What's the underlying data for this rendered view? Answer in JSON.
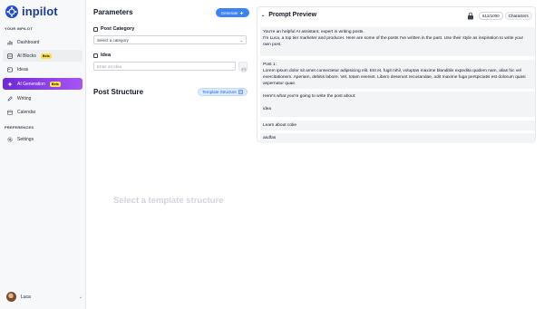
{
  "brand": {
    "name": "inpilot",
    "logo_icon": "inpilot-logo-icon",
    "color": "#1d4ed8"
  },
  "sidebar": {
    "section_main": "YOUR INPILOT",
    "items": [
      {
        "label": "Dashboard",
        "icon": "bar-chart-icon"
      },
      {
        "label": "AI Blocks",
        "icon": "blocks-icon",
        "badge": "Beta"
      },
      {
        "label": "Ideas",
        "icon": "image-icon"
      },
      {
        "label": "AI Generation",
        "icon": "sparkle-icon",
        "badge": "Beta",
        "active": true
      },
      {
        "label": "Writing",
        "icon": "pen-icon"
      },
      {
        "label": "Calendar",
        "icon": "calendar-icon"
      }
    ],
    "section_prefs": "PREFERENCES",
    "settings_label": "Settings",
    "user": {
      "name": "Luca"
    }
  },
  "params": {
    "title": "Parameters",
    "generate_label": "Generate",
    "post_category_label": "Post Category",
    "post_category_value": "Select a category",
    "idea_label": "Idea",
    "idea_placeholder": "Enter an Idea"
  },
  "structure": {
    "title": "Post Structure",
    "template_button": "Template Structure",
    "empty_message": "Select a template structure"
  },
  "preview": {
    "title": "Prompt Preview",
    "count": "612/1000",
    "unit": "Characters",
    "blocks": [
      "You're an helpful AI assistant, expert in writing posts.\nI'm Luca, a top tier marketer and producer. Here are some of the posts I've written in the past. Use their style as inspiration to write your own post.",
      "Post 1:\nLorem ipsum dolor sit amet consectetur adipisicing elit. Est et, fugit nihil, voluptas maxime blanditiis expedita quidem nam, alias hic vel exercitationem. Aperiam, debitis labore. Vel, totam eveniet. Libero deserunt recusandae, odit maxime fuga perspiciatis est dolorum quasi aspernatur quae.",
      "Here's what you're going to write the post about:\n\nidea",
      "Learn about coke",
      "asdfas"
    ]
  },
  "colors": {
    "accent": "#3b82f6",
    "active_start": "#6d28d9",
    "active_end": "#a855f7",
    "badge": "#fde047"
  }
}
